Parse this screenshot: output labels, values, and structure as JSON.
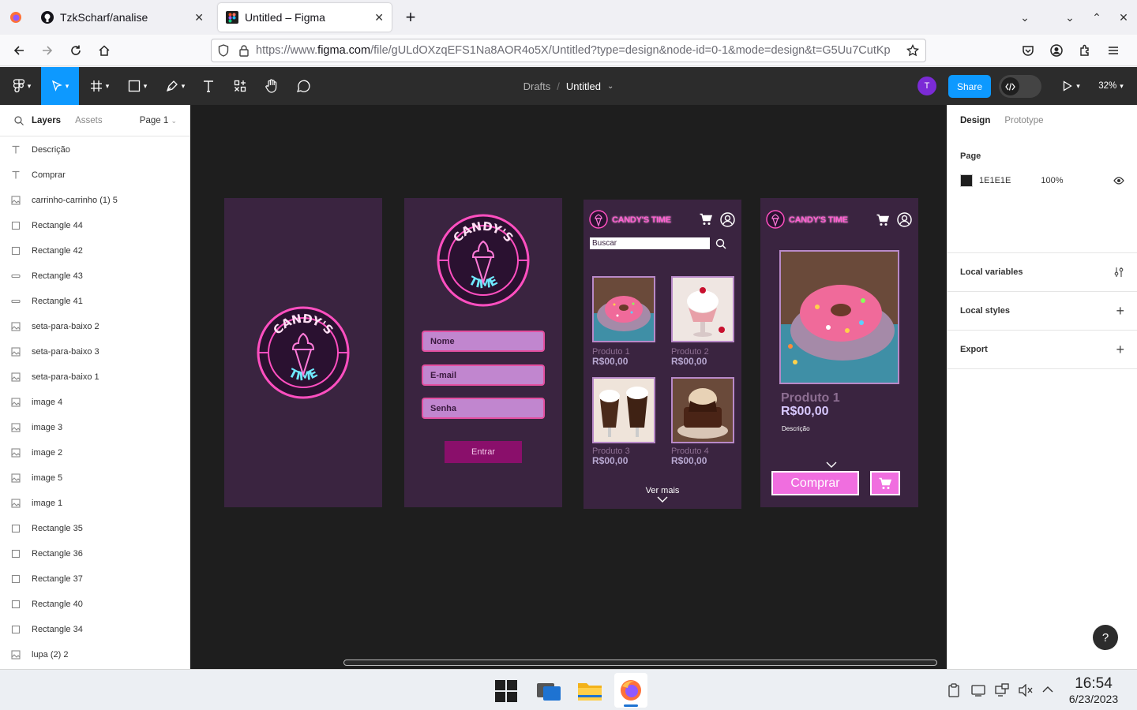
{
  "browser": {
    "tabs": [
      {
        "title": "TzkScharf/analise",
        "active": false
      },
      {
        "title": "Untitled – Figma",
        "active": true
      }
    ],
    "new_tab": "+",
    "url_prefix": "https://www.",
    "url_host": "figma.com",
    "url_rest": "/file/gULdOXzqEFS1Na8AOR4o5X/Untitled?type=design&node-id=0-1&mode=design&t=G5Uu7CutKp"
  },
  "figma": {
    "breadcrumb_parent": "Drafts",
    "breadcrumb_sep": "/",
    "file_name": "Untitled",
    "avatar_letter": "T",
    "share_label": "Share",
    "zoom": "32%",
    "left_tabs": {
      "layers": "Layers",
      "assets": "Assets",
      "page": "Page 1"
    },
    "layers": [
      {
        "name": "Descrição",
        "icon": "text-icon"
      },
      {
        "name": "Comprar",
        "icon": "text-icon"
      },
      {
        "name": "carrinho-carrinho (1) 5",
        "icon": "image-icon"
      },
      {
        "name": "Rectangle 44",
        "icon": "rect-icon"
      },
      {
        "name": "Rectangle 42",
        "icon": "rect-icon"
      },
      {
        "name": "Rectangle 43",
        "icon": "line-icon"
      },
      {
        "name": "Rectangle 41",
        "icon": "line-icon"
      },
      {
        "name": "seta-para-baixo 2",
        "icon": "image-icon"
      },
      {
        "name": "seta-para-baixo 3",
        "icon": "image-icon"
      },
      {
        "name": "seta-para-baixo 1",
        "icon": "image-icon"
      },
      {
        "name": "image 4",
        "icon": "image-icon"
      },
      {
        "name": "image 3",
        "icon": "image-icon"
      },
      {
        "name": "image 2",
        "icon": "image-icon"
      },
      {
        "name": "image 5",
        "icon": "image-icon"
      },
      {
        "name": "image 1",
        "icon": "image-icon"
      },
      {
        "name": "Rectangle 35",
        "icon": "rect-icon"
      },
      {
        "name": "Rectangle 36",
        "icon": "rect-icon"
      },
      {
        "name": "Rectangle 37",
        "icon": "rect-icon"
      },
      {
        "name": "Rectangle 40",
        "icon": "rect-icon"
      },
      {
        "name": "Rectangle 34",
        "icon": "rect-icon"
      },
      {
        "name": "lupa (2) 2",
        "icon": "image-icon"
      }
    ],
    "right_tabs": {
      "design": "Design",
      "prototype": "Prototype"
    },
    "page_section": "Page",
    "page_color": "1E1E1E",
    "page_color_hex": "#1E1E1E",
    "page_opacity": "100%",
    "sections": [
      "Local variables",
      "Local styles",
      "Export"
    ],
    "help": "?"
  },
  "design": {
    "logo_top": "CANDY'S",
    "logo_bottom": "TIME",
    "brand": "CANDY'S TIME",
    "login_fields": [
      "Nome",
      "E-mail",
      "Senha"
    ],
    "login_button": "Entrar",
    "search_placeholder": "Buscar",
    "products": [
      {
        "name": "Produto 1",
        "price": "R$00,00"
      },
      {
        "name": "Produto 2",
        "price": "R$00,00"
      },
      {
        "name": "Produto 3",
        "price": "R$00,00"
      },
      {
        "name": "Produto 4",
        "price": "R$00,00"
      }
    ],
    "see_more": "Ver mais",
    "detail_name": "Produto 1",
    "detail_price": "R$00,00",
    "detail_desc": "Descrição",
    "buy_label": "Comprar"
  },
  "taskbar": {
    "time": "16:54",
    "date": "6/23/2023"
  },
  "colors": {
    "accent": "#0d99ff",
    "avatar": "#7b2bd6",
    "frame": "#3a2440",
    "pink": "#f06edf",
    "neon": "#ff4fc0"
  }
}
